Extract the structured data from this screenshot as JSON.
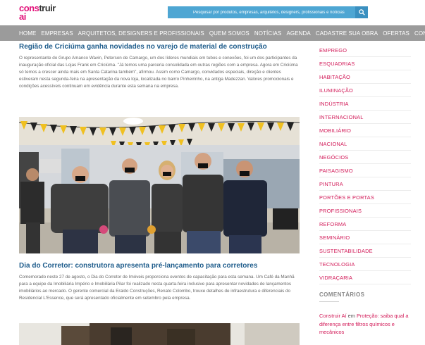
{
  "header": {
    "logo_line1": "cons",
    "logo_line1b": "truir",
    "logo_line2": "ai",
    "search_placeholder": "Pesquisar por produtos, empresas, arquitetos, designers, profissionais e notícias"
  },
  "nav": {
    "items": [
      "HOME",
      "EMPRESAS",
      "ARQUITETOS, DESIGNERS E PROFISSIONAIS",
      "QUEM SOMOS",
      "NOTÍCIAS",
      "AGENDA",
      "CADASTRE SUA OBRA",
      "OFERTAS",
      "CONTATO"
    ]
  },
  "posts": [
    {
      "title": "Região de Criciúma ganha novidades no varejo de material de construção",
      "text": "O representante do Grupo Amanco Wavin, Peterson de Camargo, um dos líderes mundiais em tubos e conexões, foi um dos participantes da inauguração oficial das Lojas Frank em Criciúma. \"Já temos uma parceria consolidada em outras regiões com a empresa. Agora em Criciúma só temos a crescer ainda mais em Santa Catarina também\", afirmou. Assim como Camargo, convidados especiais, direção e clientes estiveram nesta segunda-feira na apresentação da nova loja, localizada no bairro Pinheirinho, na antiga Madezzan. Valores promocionais e condições acessíveis continuam em evidência durante esta semana na empresa."
    },
    {
      "title": "Dia do Corretor: construtora apresenta pré-lançamento para corretores",
      "text": "Comemorado neste 27 de agosto, o Dia do Corretor de Imóveis proporciona eventos de capacitação para esta semana. Um Café da Manhã para a equipe da Imobiliária Império e Imobiliária Pilar foi realizado nesta quarta-feira inclusive para apresentar novidades de lançamentos imobiliários ao mercado. O gerente comercial da Eraldo Construções, Renato Colombo, trouxe detalhes de infraestrutura e diferenciais do Residencial L'Essence, que será apresentado oficialmente em setembro pela empresa."
    }
  ],
  "sidebar": {
    "categories": [
      "EMPREGO",
      "ESQUADRIAS",
      "HABITAÇÃO",
      "ILUMINAÇÃO",
      "INDÚSTRIA",
      "INTERNACIONAL",
      "MOBILIÁRIO",
      "NACIONAL",
      "NEGÓCIOS",
      "PAISAGISMO",
      "PINTURA",
      "PORTÕES E PORTAS",
      "PROFISSIONAIS",
      "REFORMA",
      "SEMINÁRIO",
      "SUSTENTABILIDADE",
      "TECNOLOGIA",
      "VIDRAÇARIA"
    ],
    "comments_heading": "COMENTÁRIOS",
    "comment_link_prefix": "Construir Aí",
    "comment_link_mid": " em ",
    "comment_link_text": "Proteção: saiba qual a diferença entre filtros químicos e mecânicos"
  },
  "colors": {
    "accent_pink": "#e2127a",
    "nav_gray": "#9b9b9b",
    "search_blue": "#4ea6d3",
    "title_blue": "#1f5d8c"
  }
}
